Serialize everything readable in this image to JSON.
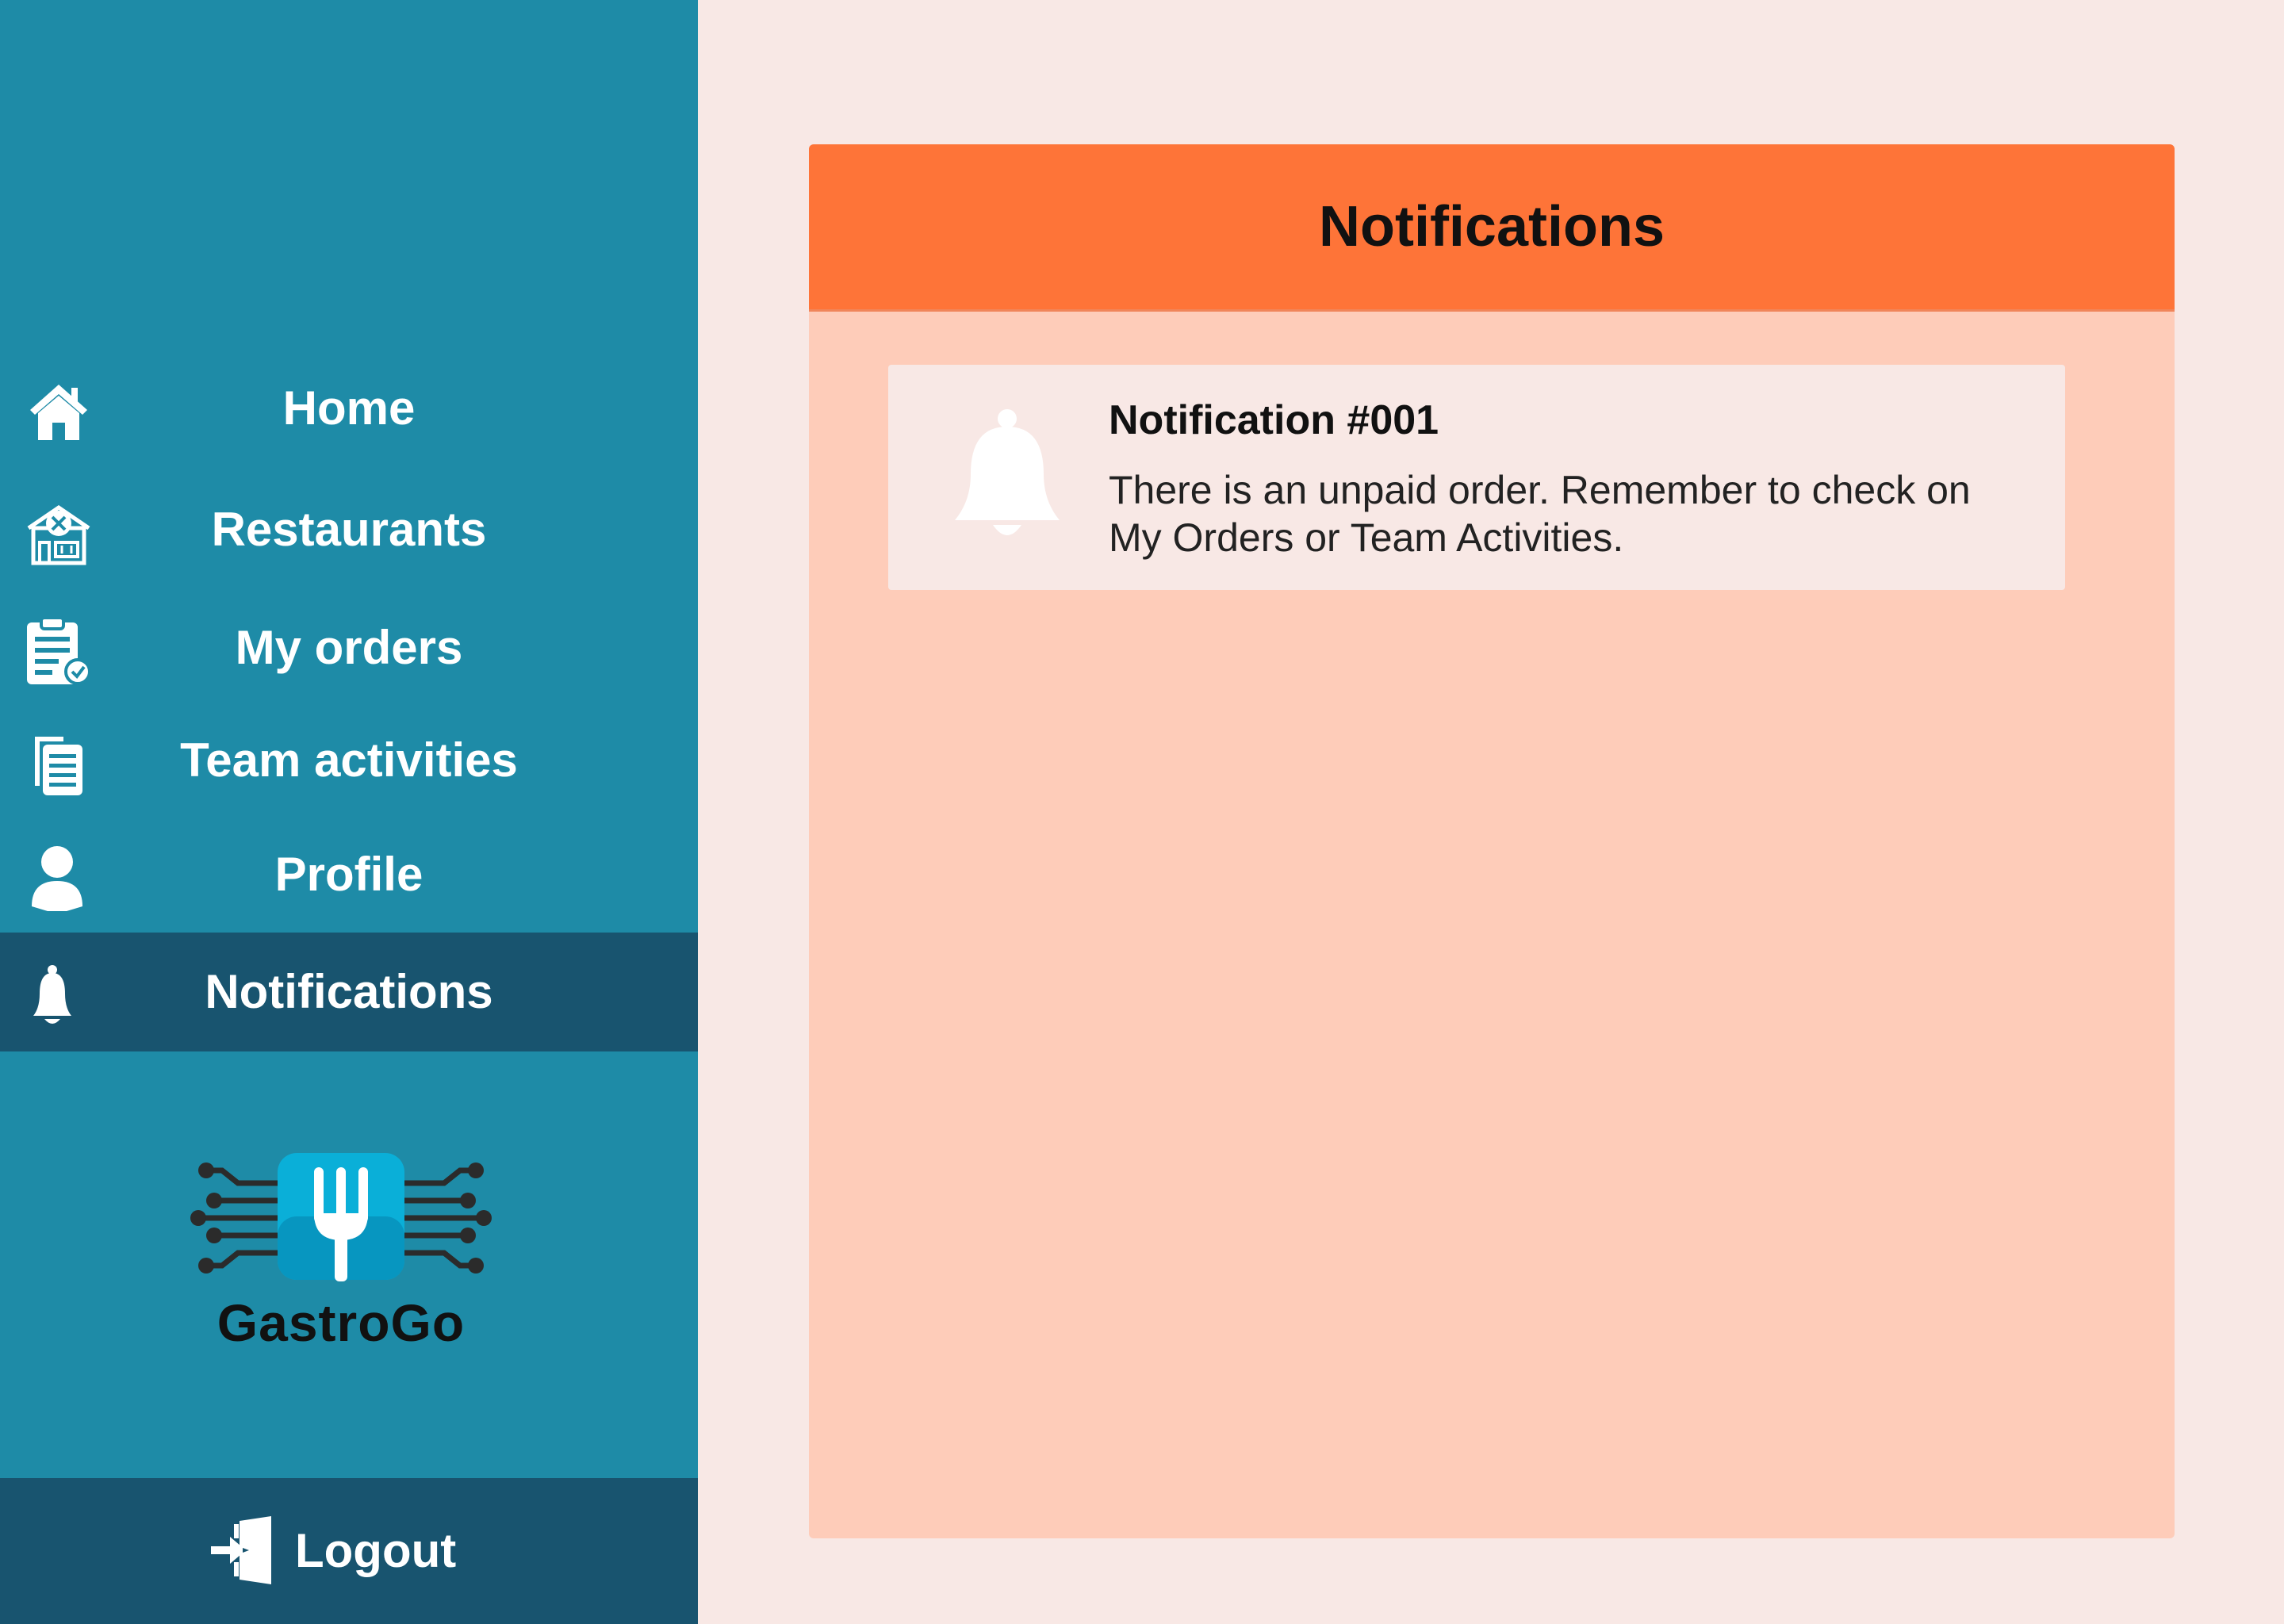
{
  "sidebar": {
    "items": [
      {
        "label": "Home",
        "icon": "home-icon"
      },
      {
        "label": "Restaurants",
        "icon": "restaurant-icon"
      },
      {
        "label": "My orders",
        "icon": "clipboard-check-icon"
      },
      {
        "label": "Team activities",
        "icon": "documents-icon"
      },
      {
        "label": "Profile",
        "icon": "user-icon"
      },
      {
        "label": "Notifications",
        "icon": "bell-icon",
        "active": true
      }
    ],
    "logo_text": "GastroGo",
    "logout_label": "Logout"
  },
  "main": {
    "title": "Notifications",
    "notifications": [
      {
        "title": "Notification #001",
        "message": "There is an unpaid order. Remember to check on My Orders or Team Activities."
      }
    ]
  },
  "colors": {
    "sidebar": "#1E8BA7",
    "sidebar_active": "#18546F",
    "header": "#FE7438",
    "panel": "#FECCB9",
    "background": "#F8E8E5"
  }
}
